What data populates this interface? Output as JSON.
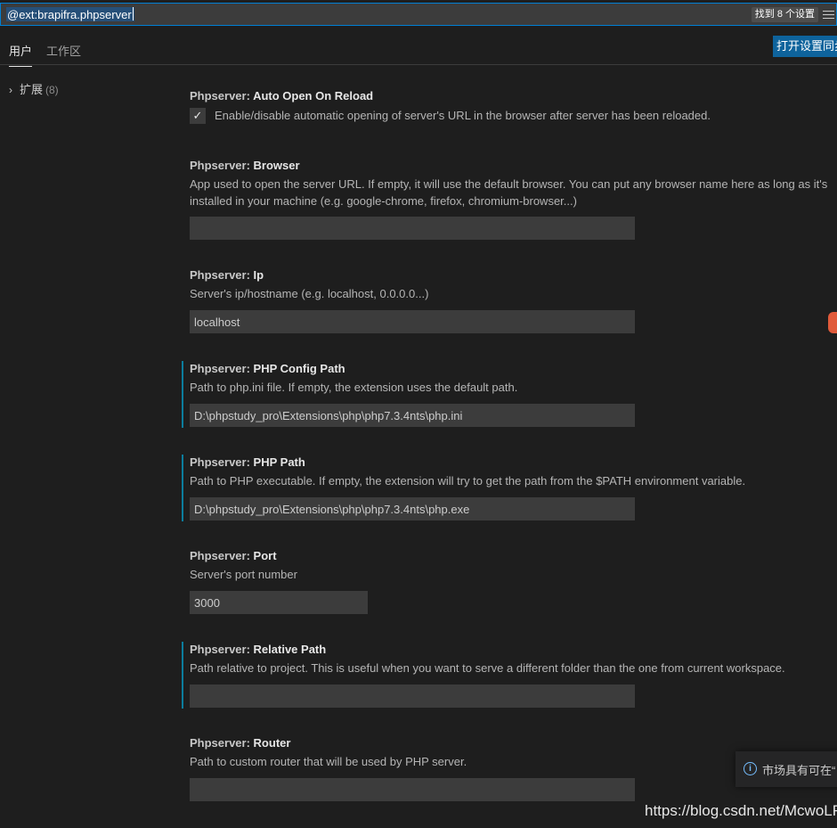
{
  "search": {
    "value": "@ext:brapifra.phpserver",
    "result_count": "找到 8 个设置",
    "filter_icon": "filter-list-icon"
  },
  "tabs": [
    {
      "label": "用户",
      "active": true
    },
    {
      "label": "工作区",
      "active": false
    }
  ],
  "sync_button_label": "打开设置同步",
  "tree": {
    "label": "扩展",
    "count": "(8)",
    "icon": "chevron-right-icon"
  },
  "settings": [
    {
      "category": "Phpserver: ",
      "name": "Auto Open On Reload",
      "description": "Enable/disable automatic opening of server's URL in the browser after server has been reloaded.",
      "type": "checkbox",
      "checked": true
    },
    {
      "category": "Phpserver: ",
      "name": "Browser",
      "description": "App used to open the server URL. If empty, it will use the default browser. You can put any browser name here as long as it's installed in your machine (e.g. google-chrome, firefox, chromium-browser...)",
      "type": "text",
      "value": ""
    },
    {
      "category": "Phpserver: ",
      "name": "Ip",
      "description": "Server's ip/hostname (e.g. localhost, 0.0.0.0...)",
      "type": "text",
      "value": "localhost"
    },
    {
      "category": "Phpserver: ",
      "name": "PHP Config Path",
      "description": "Path to php.ini file. If empty, the extension uses the default path.",
      "type": "text",
      "value": "D:\\phpstudy_pro\\Extensions\\php\\php7.3.4nts\\php.ini",
      "modified": true
    },
    {
      "category": "Phpserver: ",
      "name": "PHP Path",
      "description": "Path to PHP executable. If empty, the extension will try to get the path from the $PATH environment variable.",
      "type": "text",
      "value": "D:\\phpstudy_pro\\Extensions\\php\\php7.3.4nts\\php.exe",
      "modified": true
    },
    {
      "category": "Phpserver: ",
      "name": "Port",
      "description": "Server's port number",
      "type": "number",
      "value": "3000"
    },
    {
      "category": "Phpserver: ",
      "name": "Relative Path",
      "description": "Path relative to project. This is useful when you want to serve a different folder than the one from current workspace.",
      "type": "text",
      "value": "",
      "modified": true
    },
    {
      "category": "Phpserver: ",
      "name": "Router",
      "description": "Path to custom router that will be used by PHP server.",
      "type": "text",
      "value": ""
    }
  ],
  "notification": {
    "text": "市场具有可在“",
    "icon": "info-icon"
  },
  "watermark": "https://blog.csdn.net/McwoLF",
  "colors": {
    "accent": "#007fd4",
    "button": "#0e639c",
    "modified_bar": "#0c7d9d",
    "background": "#1e1e1e"
  }
}
